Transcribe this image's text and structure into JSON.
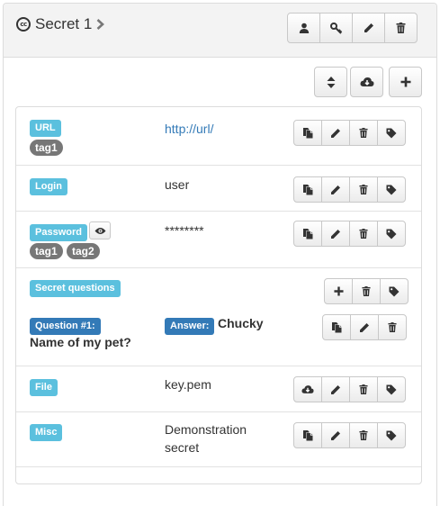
{
  "header": {
    "cc_badge": "cc",
    "title": "Secret 1",
    "buttons": [
      "user-icon",
      "key-icon",
      "pencil-icon",
      "trash-icon"
    ]
  },
  "toolbar": {
    "buttons": [
      "sort-icon",
      "cloud-download-icon",
      "plus-icon"
    ]
  },
  "fields": {
    "url": {
      "label": "URL",
      "value": "http://url/",
      "tags": [
        "tag1"
      ]
    },
    "login": {
      "label": "Login",
      "value": "user"
    },
    "password": {
      "label": "Password",
      "value": "********",
      "tags": [
        "tag1",
        "tag2"
      ]
    },
    "secret_questions": {
      "label": "Secret questions",
      "question_label": "Question #1:",
      "question": "Name of my pet?",
      "answer_label": "Answer:",
      "answer": "Chucky"
    },
    "file": {
      "label": "File",
      "value": "key.pem"
    },
    "misc": {
      "label": "Misc",
      "value_line1": "Demonstration",
      "value_line2": "secret"
    }
  },
  "colors": {
    "info_label": "#5bc0de",
    "primary_label": "#337ab7",
    "tag": "#777777",
    "link": "#337ab7"
  }
}
